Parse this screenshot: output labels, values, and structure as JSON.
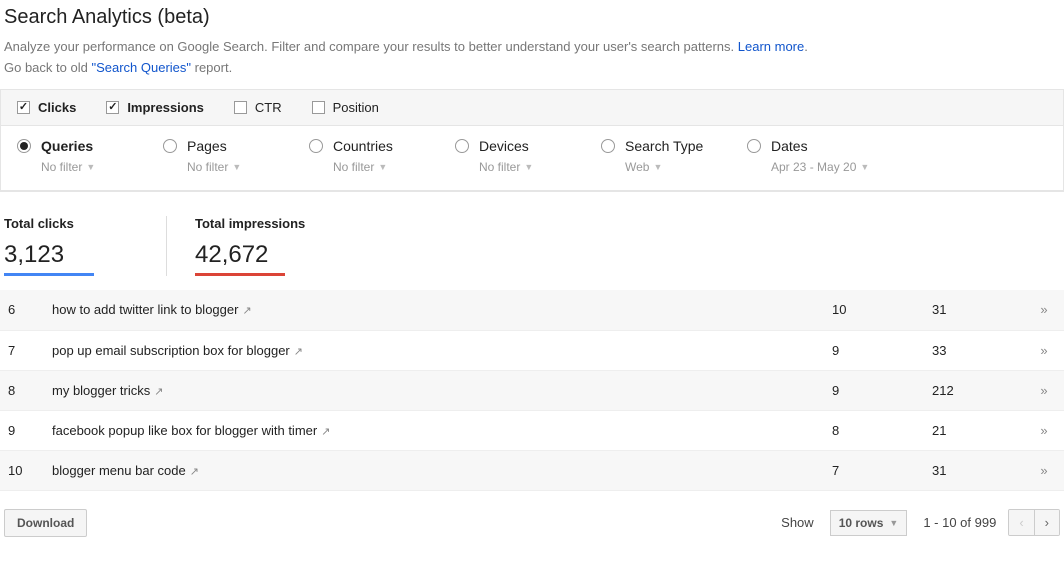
{
  "page": {
    "title": "Search Analytics (beta)",
    "subtitle_pre": "Analyze your performance on Google Search. Filter and compare your results to better understand your user's search patterns. ",
    "learn_more": "Learn more",
    "subtitle_post": ".",
    "goback_pre": "Go back to old ",
    "goback_link": "\"Search Queries\"",
    "goback_post": " report."
  },
  "metrics": {
    "clicks": "Clicks",
    "impressions": "Impressions",
    "ctr": "CTR",
    "position": "Position"
  },
  "dims": {
    "queries": {
      "label": "Queries",
      "sub": "No filter"
    },
    "pages": {
      "label": "Pages",
      "sub": "No filter"
    },
    "countries": {
      "label": "Countries",
      "sub": "No filter"
    },
    "devices": {
      "label": "Devices",
      "sub": "No filter"
    },
    "search_type": {
      "label": "Search Type",
      "sub": "Web"
    },
    "dates": {
      "label": "Dates",
      "sub": "Apr 23 - May 20"
    }
  },
  "totals": {
    "clicks_label": "Total clicks",
    "clicks_value": "3,123",
    "impressions_label": "Total impressions",
    "impressions_value": "42,672"
  },
  "rows": [
    {
      "idx": "6",
      "query": "how to add twitter link to blogger",
      "clicks": "10",
      "impressions": "31"
    },
    {
      "idx": "7",
      "query": "pop up email subscription box for blogger",
      "clicks": "9",
      "impressions": "33"
    },
    {
      "idx": "8",
      "query": "my blogger tricks",
      "clicks": "9",
      "impressions": "212"
    },
    {
      "idx": "9",
      "query": "facebook popup like box for blogger with timer",
      "clicks": "8",
      "impressions": "21"
    },
    {
      "idx": "10",
      "query": "blogger menu bar code",
      "clicks": "7",
      "impressions": "31"
    }
  ],
  "footer": {
    "download": "Download",
    "show_label": "Show",
    "rows_select": "10 rows",
    "range": "1 - 10 of 999"
  }
}
